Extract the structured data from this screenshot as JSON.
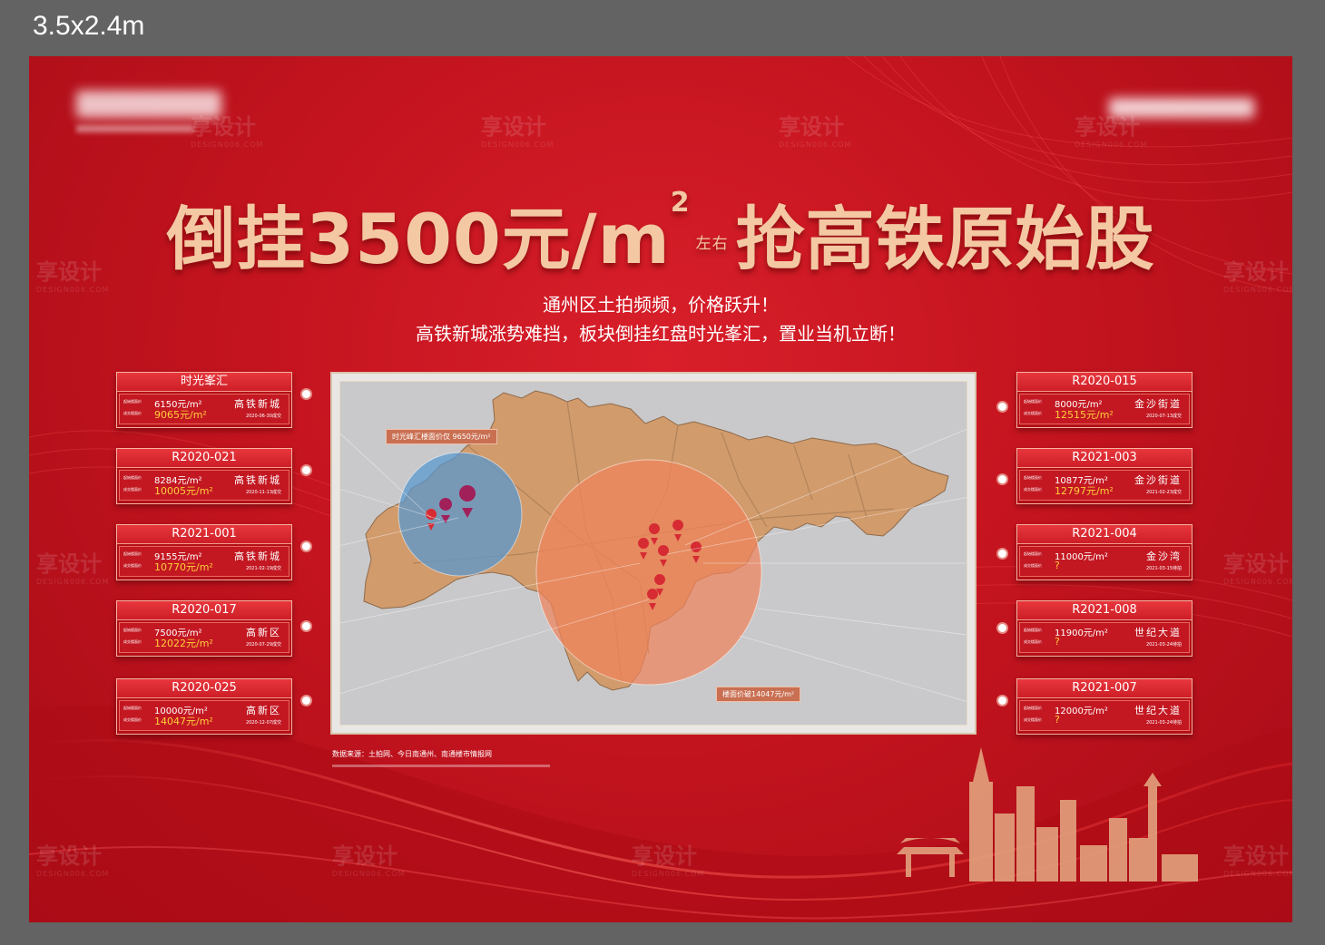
{
  "size_label": "3.5x2.4m",
  "headline": {
    "part1": "倒挂3500元/m",
    "sup": "2",
    "small": "左右",
    "part2": "抢高铁原始股"
  },
  "subtitle": {
    "line1": "通州区土拍频频，价格跃升！",
    "line2": "高铁新城涨势难挡，板块倒挂红盘时光峯汇，置业当机立断！"
  },
  "map": {
    "callout_blue": "时光峰汇楼面价仅 9650元/m²",
    "callout_orange": "楼面价破14047元/m²"
  },
  "row_labels": {
    "start": "起始楼面价",
    "deal": "成交楼面价"
  },
  "cards_left": [
    {
      "title": "时光峯汇",
      "start_price": "6150元/m²",
      "deal_price": "9065元/m²",
      "area": "高铁新城",
      "date": "2020-06-30成交"
    },
    {
      "title": "R2020-021",
      "start_price": "8284元/m²",
      "deal_price": "10005元/m²",
      "area": "高铁新城",
      "date": "2020-11-13成交"
    },
    {
      "title": "R2021-001",
      "start_price": "9155元/m²",
      "deal_price": "10770元/m²",
      "area": "高铁新城",
      "date": "2021-02-19成交"
    },
    {
      "title": "R2020-017",
      "start_price": "7500元/m²",
      "deal_price": "12022元/m²",
      "area": "高新区",
      "date": "2020-07-29成交"
    },
    {
      "title": "R2020-025",
      "start_price": "10000元/m²",
      "deal_price": "14047元/m²",
      "area": "高新区",
      "date": "2020-12-07成交"
    }
  ],
  "cards_right": [
    {
      "title": "R2020-015",
      "start_price": "8000元/m²",
      "deal_price": "12515元/m²",
      "area": "金沙街道",
      "date": "2020-07-13成交"
    },
    {
      "title": "R2021-003",
      "start_price": "10877元/m²",
      "deal_price": "12797元/m²",
      "area": "金沙街道",
      "date": "2021-02-23成交"
    },
    {
      "title": "R2021-004",
      "start_price": "11000元/m²",
      "deal_price": "?",
      "area": "金沙湾",
      "date": "2021-03-15待拍"
    },
    {
      "title": "R2021-008",
      "start_price": "11900元/m²",
      "deal_price": "?",
      "area": "世纪大道",
      "date": "2021-03-24待拍"
    },
    {
      "title": "R2021-007",
      "start_price": "12000元/m²",
      "deal_price": "?",
      "area": "世纪大道",
      "date": "2021-03-24待拍"
    }
  ],
  "source": "数据来源：土拍网、今日南通州、南通楼市情报网",
  "watermark": {
    "text": "享设计",
    "sub": "DESIGN006.COM"
  },
  "colors": {
    "board": "#c4141f",
    "accent_gold": "#f3c8a2",
    "price_yellow": "#ffcf3a",
    "map_land": "#d19b6c",
    "circle_blue": "#5a98cf",
    "circle_orange": "#f0845c",
    "pin": "#d62b33"
  }
}
